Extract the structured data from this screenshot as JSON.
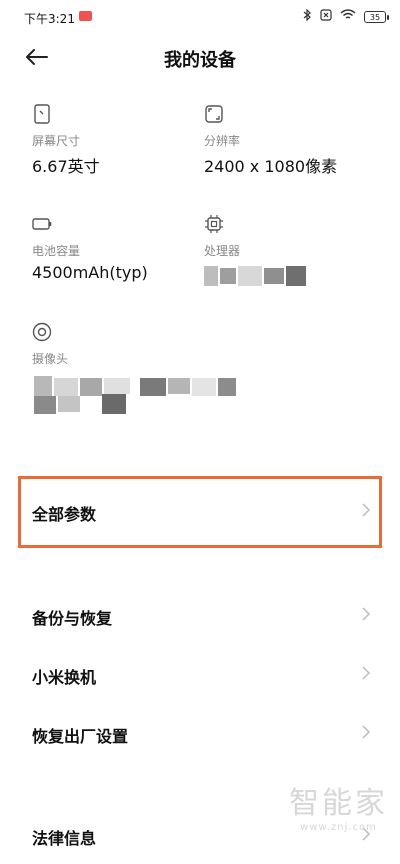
{
  "status_bar": {
    "time": "下午3:21",
    "battery": "35"
  },
  "header": {
    "back_icon": "arrow-left-icon",
    "title": "我的设备"
  },
  "specs": [
    {
      "icon": "screen-icon",
      "label": "屏幕尺寸",
      "value": "6.67英寸"
    },
    {
      "icon": "resolution-icon",
      "label": "分辨率",
      "value": "2400 x 1080像素"
    },
    {
      "icon": "battery-icon",
      "label": "电池容量",
      "value": "4500mAh(typ)"
    },
    {
      "icon": "chip-icon",
      "label": "处理器",
      "value": ""
    },
    {
      "icon": "camera-icon",
      "label": "摄像头",
      "value": ""
    }
  ],
  "menu": [
    {
      "label": "全部参数"
    },
    {
      "label": "备份与恢复"
    },
    {
      "label": "小米换机"
    },
    {
      "label": "恢复出厂设置"
    },
    {
      "label": "法律信息"
    }
  ],
  "highlight_color": "#ec6a35",
  "watermark": {
    "title": "智能家",
    "url": "www.znj.com"
  }
}
